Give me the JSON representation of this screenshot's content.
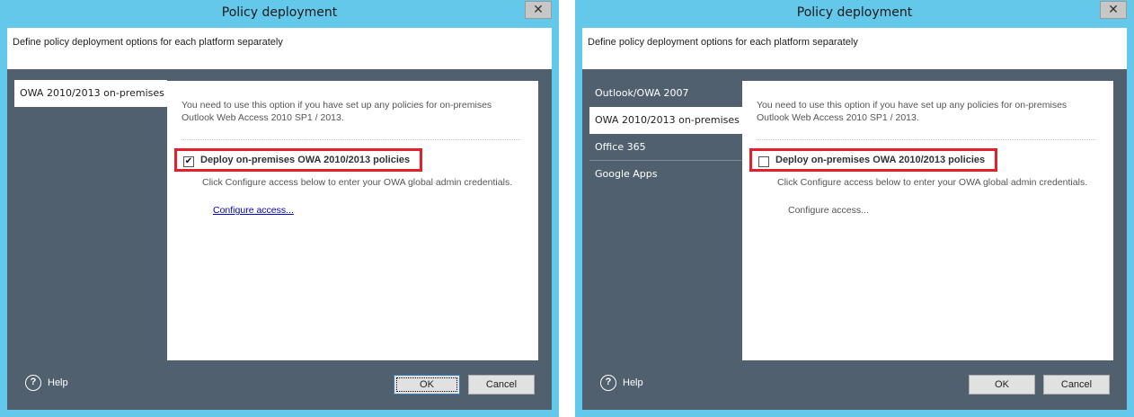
{
  "dialogs": [
    {
      "title": "Policy deployment",
      "close_glyph": "✕",
      "description": "Define policy deployment options for each platform separately",
      "nav_items": [
        "OWA 2010/2013 on-premises"
      ],
      "selected_nav": "OWA 2010/2013 on-premises",
      "intro": "You need to use this option if you have set up any policies for on-premises Outlook Web Access 2010 SP1 / 2013.",
      "deploy_label": "Deploy on-premises OWA 2010/2013 policies",
      "deploy_checked": true,
      "check_glyph": "✔",
      "click_text": "Click Configure access below to enter your OWA global admin credentials.",
      "configure_label": "Configure access...",
      "help_glyph": "?",
      "help_label": "Help",
      "ok_label": "OK",
      "cancel_label": "Cancel"
    },
    {
      "title": "Policy deployment",
      "close_glyph": "✕",
      "description": "Define policy deployment options for each platform separately",
      "nav_items": [
        "Outlook/OWA 2007",
        "OWA 2010/2013 on-premises",
        "Office 365",
        "Google Apps"
      ],
      "selected_nav": "OWA 2010/2013 on-premises",
      "intro": "You need to use this option if you have set up any policies for on-premises Outlook Web Access 2010 SP1 / 2013.",
      "deploy_label": "Deploy on-premises OWA 2010/2013 policies",
      "deploy_checked": false,
      "check_glyph": "",
      "click_text": "Click Configure access below to enter your OWA global admin credentials.",
      "configure_label": "Configure access...",
      "help_glyph": "?",
      "help_label": "Help",
      "ok_label": "OK",
      "cancel_label": "Cancel"
    }
  ],
  "colors": {
    "titlebar": "#64c8ea",
    "body_background": "#51606f",
    "highlight_border": "#e0202a",
    "link": "#0000cc"
  },
  "icons": [
    "close-icon",
    "checkmark-icon",
    "help-icon"
  ]
}
